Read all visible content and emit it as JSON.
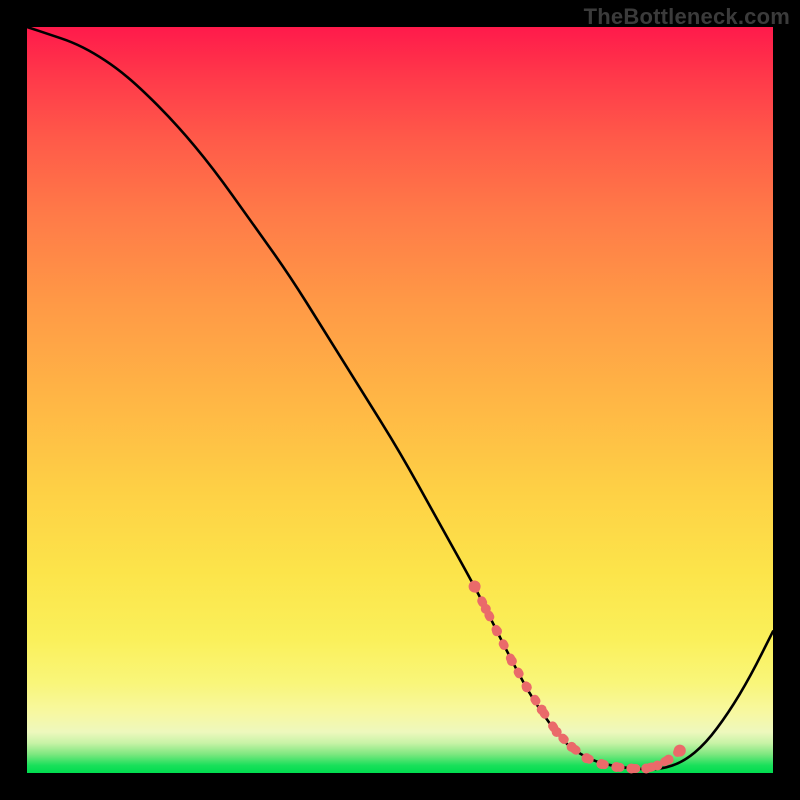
{
  "watermark": "TheBottleneck.com",
  "colors": {
    "curve_stroke": "#000000",
    "dot_fill": "#ea6a6a",
    "gradient_top": "#ff1a4b",
    "gradient_bottom": "#00dc4f",
    "frame": "#000000"
  },
  "chart_data": {
    "type": "line",
    "title": "",
    "xlabel": "",
    "ylabel": "",
    "xlim": [
      0,
      100
    ],
    "ylim": [
      0,
      100
    ],
    "series": [
      {
        "name": "bottleneck-curve",
        "x": [
          0,
          3,
          6,
          9,
          12,
          15,
          20,
          25,
          30,
          35,
          40,
          45,
          50,
          55,
          60,
          62,
          65,
          68,
          72,
          75,
          78,
          82,
          85,
          88,
          91,
          94,
          97,
          100
        ],
        "y": [
          100,
          99,
          98,
          96.5,
          94.5,
          92,
          87,
          81,
          74,
          67,
          59,
          51,
          43,
          34,
          25,
          21,
          15,
          9.5,
          4,
          2,
          1,
          0.5,
          0.5,
          1.5,
          4,
          8,
          13,
          19
        ]
      }
    ],
    "dots": {
      "name": "highlighted-range",
      "x": [
        60,
        61.5,
        63,
        65,
        67,
        69,
        71,
        73,
        75,
        77,
        79,
        81,
        83,
        84.5,
        86,
        87.5
      ],
      "y": [
        25,
        22,
        19,
        15,
        11.5,
        8.5,
        5.5,
        3.5,
        2,
        1.2,
        0.8,
        0.6,
        0.6,
        1.0,
        1.8,
        3.0
      ]
    }
  }
}
